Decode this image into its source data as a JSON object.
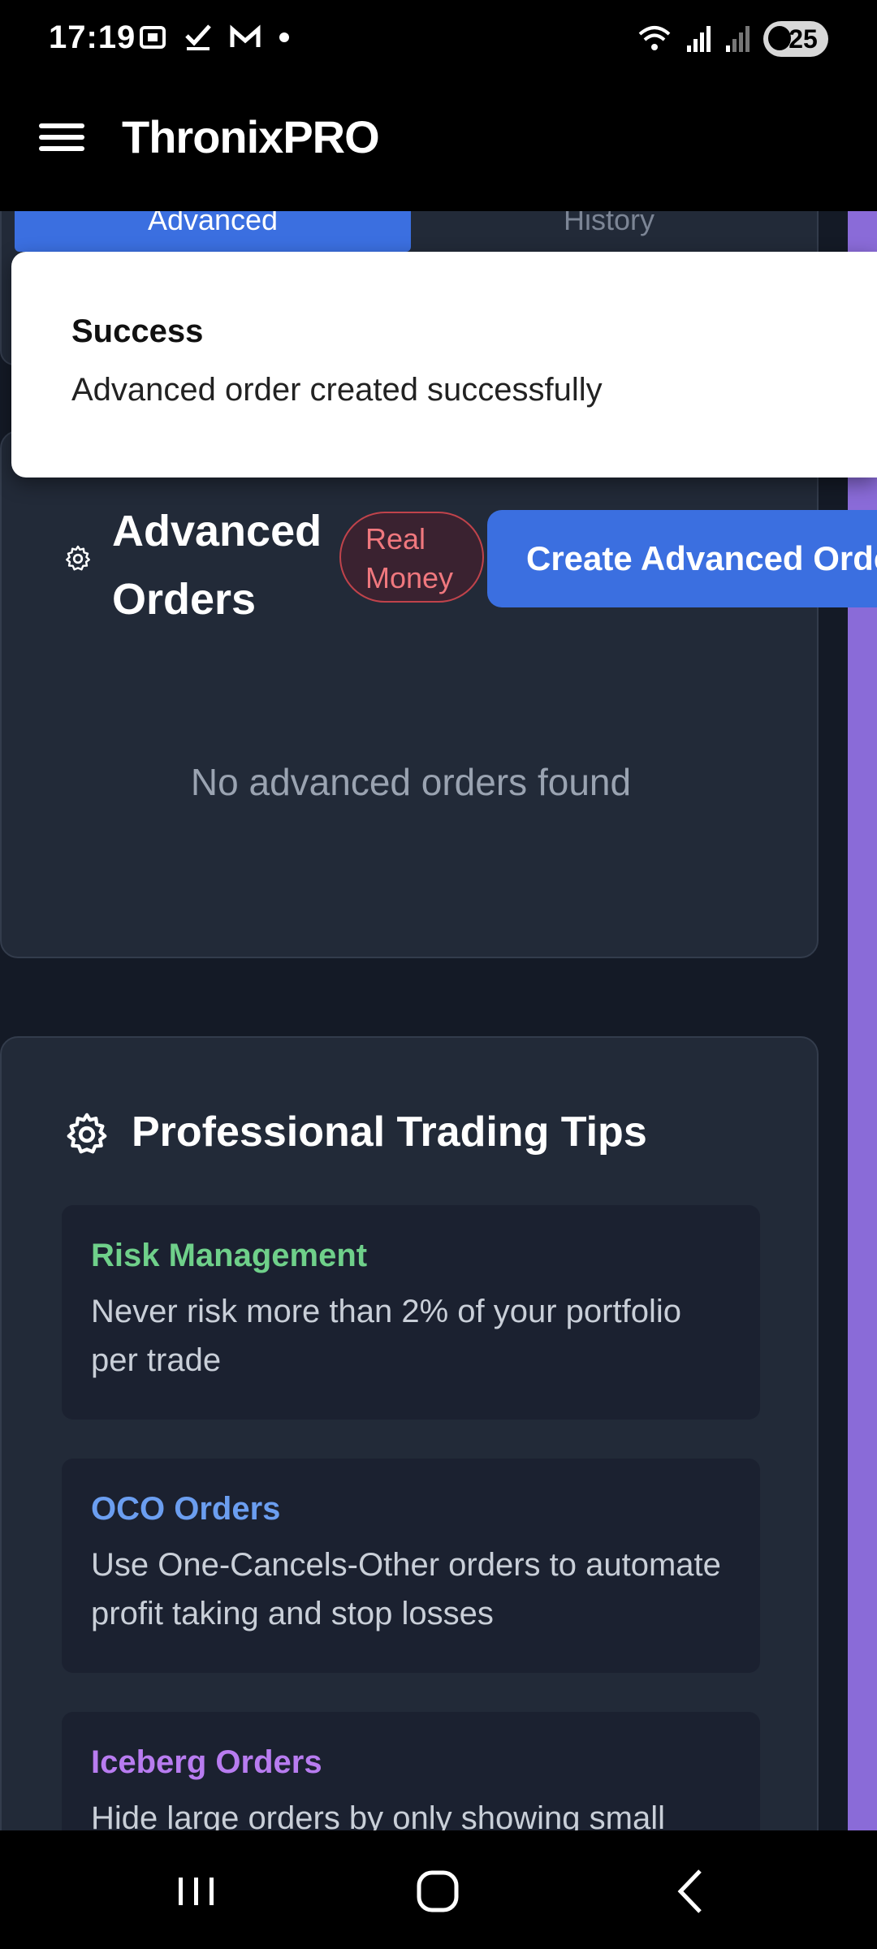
{
  "status_bar": {
    "time": "17:19",
    "notification_icons": [
      "screenshot-icon",
      "check-icon",
      "gmail-icon",
      "dot-icon"
    ],
    "battery": "25"
  },
  "app_bar": {
    "title": "ThronixPRO"
  },
  "tabs": [
    {
      "label": "Advanced",
      "active": true
    },
    {
      "label": "History",
      "active": false
    }
  ],
  "toast": {
    "title": "Success",
    "message": "Advanced order created successfully"
  },
  "orders": {
    "title": "Advanced Orders",
    "badge": "Real Money",
    "create_button": "Create Advanced Order",
    "empty_message": "No advanced orders found"
  },
  "tips": {
    "title": "Professional Trading Tips",
    "items": [
      {
        "title": "Risk Management",
        "description": "Never risk more than 2% of your portfolio per trade",
        "color": "#6fd08a"
      },
      {
        "title": "OCO Orders",
        "description": "Use One-Cancels-Other orders to automate profit taking and stop losses",
        "color": "#6b9ef0"
      },
      {
        "title": "Iceberg Orders",
        "description": "Hide large orders by only showing small",
        "color": "#b87cf0"
      }
    ]
  },
  "colors": {
    "accent": "#3b6fe0",
    "card": "#222a38",
    "background": "#141a26",
    "badge_red": "#f0787e",
    "side_strip": "#8a6bd8"
  }
}
